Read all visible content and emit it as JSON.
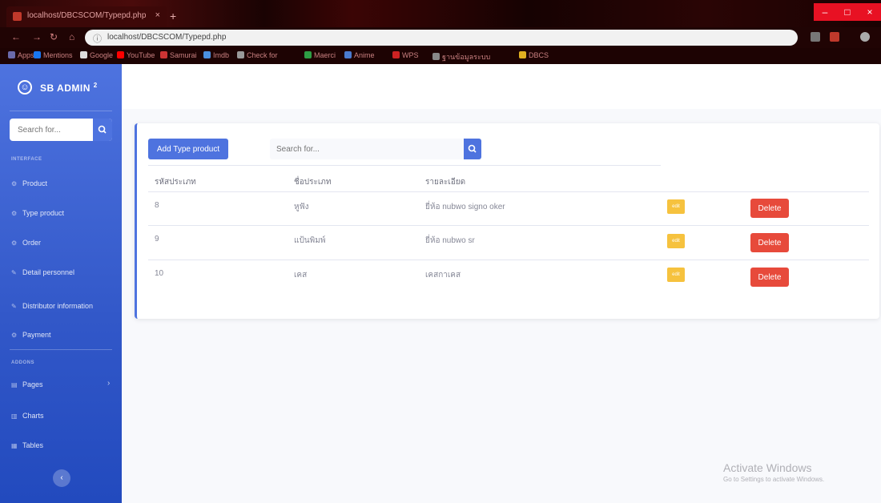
{
  "browser": {
    "tab_title": "localhost/DBCSCOM/Typepd.php",
    "tab_close": "×",
    "new_tab": "+",
    "url": "localhost/DBCSCOM/Typepd.php",
    "bookmarks": [
      {
        "label": "Apps",
        "color": "#6a6aaa"
      },
      {
        "label": "Mentions",
        "color": "#1877f2"
      },
      {
        "label": "Google",
        "color": "#dddddd"
      },
      {
        "label": "YouTube",
        "color": "#ff0000"
      },
      {
        "label": "Samurai",
        "color": "#cc3333"
      },
      {
        "label": "Imdb",
        "color": "#4a8fe0"
      },
      {
        "label": "Check for",
        "color": "#999999"
      },
      {
        "label": "Maerci",
        "color": "#2e9e44"
      },
      {
        "label": "Anime",
        "color": "#4a7bd0"
      },
      {
        "label": "WPS",
        "color": "#cc2222"
      },
      {
        "label": "ฐานข้อมูลระบบ",
        "color": "#888888"
      },
      {
        "label": "DBCS",
        "color": "#e0b020"
      }
    ]
  },
  "sidebar": {
    "brand": "SB ADMIN",
    "brand_sup": "2",
    "search_placeholder": "Search for...",
    "heading_interface": "INTERFACE",
    "heading_addons": "ADDONS",
    "items": [
      {
        "label": "Product"
      },
      {
        "label": "Type product"
      },
      {
        "label": "Order"
      },
      {
        "label": "Detail personnel"
      },
      {
        "label": "Distributor information"
      },
      {
        "label": "Payment"
      },
      {
        "label": "Pages"
      },
      {
        "label": "Charts"
      },
      {
        "label": "Tables"
      }
    ],
    "toggle": "‹"
  },
  "main": {
    "add_button": "Add Type product",
    "search_placeholder": "Search for...",
    "columns": [
      "รหัสประเภท",
      "ชื่อประเภท",
      "รายละเอียด"
    ],
    "rows": [
      {
        "id": "8",
        "name": "หูฟัง",
        "detail": "ยี่ห้อ nubwo signo oker",
        "edit": "edit",
        "delete": "Delete"
      },
      {
        "id": "9",
        "name": "แป้นพิมพ์",
        "detail": "ยี่ห้อ nubwo sr",
        "edit": "edit",
        "delete": "Delete"
      },
      {
        "id": "10",
        "name": "เคส",
        "detail": "เคสกาเคส",
        "edit": "edit",
        "delete": "Delete"
      }
    ]
  },
  "watermark": {
    "line1": "Activate Windows",
    "line2": "Go to Settings to activate Windows."
  },
  "colors": {
    "primary": "#4e73df",
    "warning": "#f6c23e",
    "danger": "#e74a3b"
  }
}
